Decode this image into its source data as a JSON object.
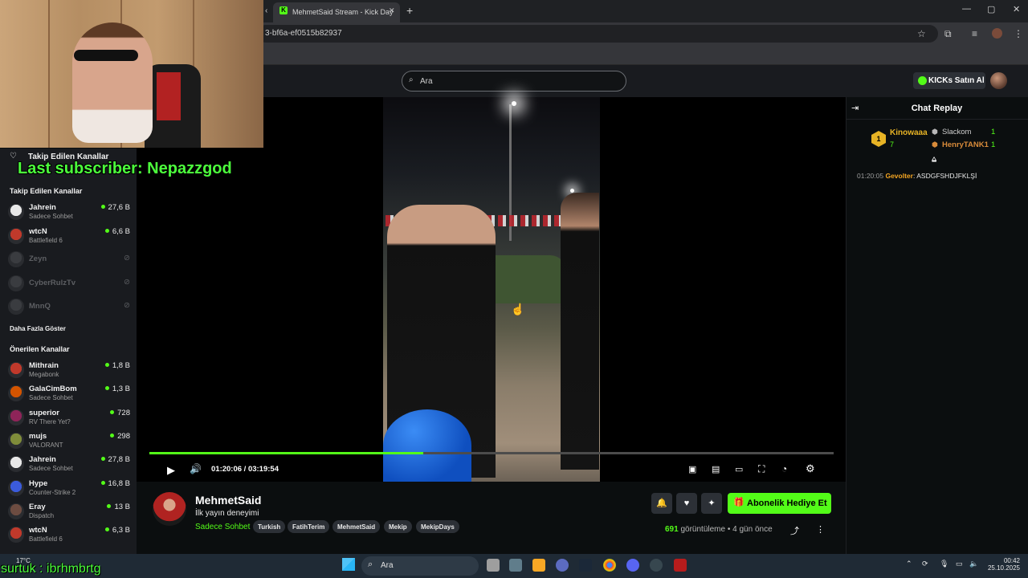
{
  "browser": {
    "tab_title": "MehmetSaid Stream - Kick Day",
    "url": "3-bf6a-ef0515b82937",
    "win_min": "—",
    "win_max": "▢",
    "win_close": "✕"
  },
  "header": {
    "search_placeholder": "Ara",
    "kicks_button": "KICKs Satın Al"
  },
  "overlay": {
    "last_subscriber": "Last subscriber: Nepazzgod",
    "bottom_text": "surtuk : ibrhmbrtg"
  },
  "sidebar": {
    "top_heading": "Takip Edilen Kanallar",
    "followed_heading": "Takip Edilen Kanallar",
    "followed": [
      {
        "name": "Jahrein",
        "category": "Sadece Sohbet",
        "viewers": "27,6 B",
        "live": true,
        "color": "#e8e8e8"
      },
      {
        "name": "wtcN",
        "category": "Battlefield 6",
        "viewers": "6,6 B",
        "live": true,
        "color": "#c0392b"
      },
      {
        "name": "Zeyn",
        "category": "",
        "viewers": "",
        "live": false,
        "color": "#3a3c40"
      },
      {
        "name": "CyberRulzTv",
        "category": "",
        "viewers": "",
        "live": false,
        "color": "#3a3c40"
      },
      {
        "name": "MnnQ",
        "category": "",
        "viewers": "",
        "live": false,
        "color": "#3a3c40"
      }
    ],
    "show_more": "Daha Fazla Göster",
    "recommended_heading": "Önerilen Kanallar",
    "recommended": [
      {
        "name": "Mithrain",
        "category": "Megabonk",
        "viewers": "1,8 B",
        "color": "#c0392b"
      },
      {
        "name": "GalaCimBom",
        "category": "Sadece Sohbet",
        "viewers": "1,3 B",
        "color": "#d35400"
      },
      {
        "name": "superior",
        "category": "RV There Yet?",
        "viewers": "728",
        "color": "#8e2459"
      },
      {
        "name": "mujs",
        "category": "VALORANT",
        "viewers": "298",
        "color": "#7f8c3a"
      },
      {
        "name": "Jahrein",
        "category": "Sadece Sohbet",
        "viewers": "27,8 B",
        "color": "#e8e8e8"
      },
      {
        "name": "Hype",
        "category": "Counter-Strike 2",
        "viewers": "16,8 B",
        "color": "#3b5bdb"
      },
      {
        "name": "Eray",
        "category": "Dispatch",
        "viewers": "13 B",
        "color": "#6d4c41"
      },
      {
        "name": "wtcN",
        "category": "Battlefield 6",
        "viewers": "6,3 B",
        "color": "#c0392b"
      }
    ]
  },
  "player": {
    "time": "01:20:06 / 03:19:54",
    "progress_fraction": 0.4,
    "play_icon": "▶",
    "volume_icon": "🔊"
  },
  "channel": {
    "name": "MehmetSaid",
    "title": "İlk yayın deneyimi",
    "category": "Sadece Sohbet",
    "tags": [
      "Turkish",
      "FatihTerim",
      "MehmetSaid",
      "Mekip",
      "MekipDays"
    ],
    "gift_button": "Abonelik Hediye Et",
    "views_count": "691",
    "views_label": "görüntüleme",
    "separator": "•",
    "age": "4 gün önce"
  },
  "chat": {
    "title": "Chat Replay",
    "top_gifters": [
      {
        "name": "Kinowaaa",
        "count": "7",
        "rank": "1"
      },
      {
        "name": "Slackom",
        "count": "1"
      },
      {
        "name": "HenryTANK1",
        "count": "1"
      }
    ],
    "messages": [
      {
        "time": "01:20:05",
        "user": "Gevolter",
        "text": "ASDGFSHDJFKLŞİ"
      }
    ]
  },
  "taskbar": {
    "search": "Ara",
    "weather": "17°C",
    "time": "00:42",
    "date": "25.10.2025"
  }
}
